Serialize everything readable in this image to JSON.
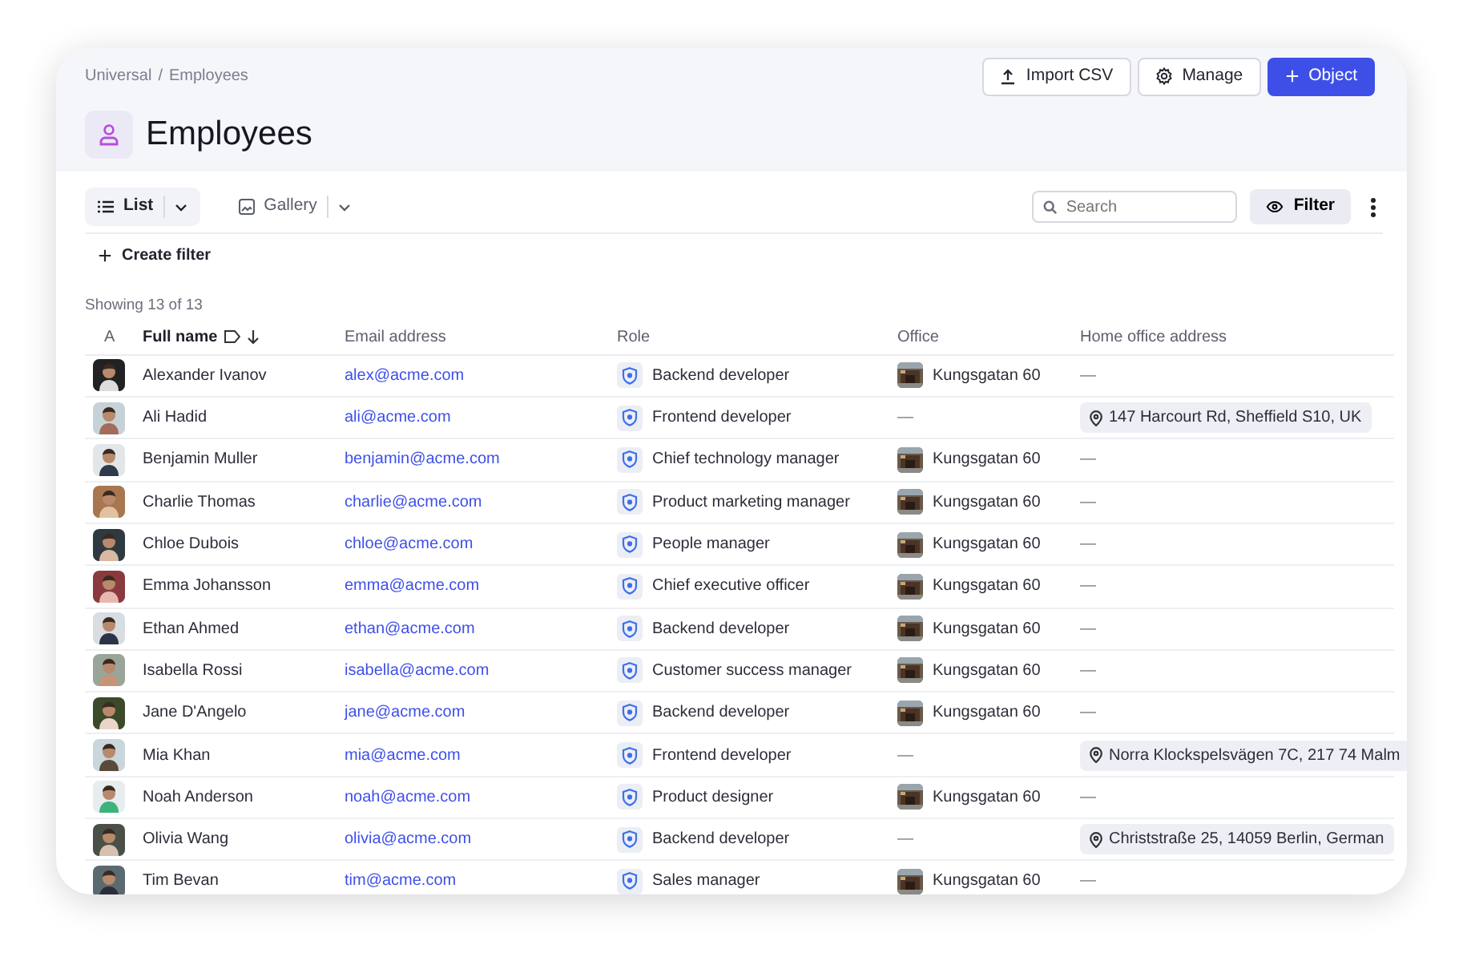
{
  "breadcrumbs": [
    "Universal",
    "Employees"
  ],
  "breadcrumb_separator": "/",
  "title": "Employees",
  "actions": [
    {
      "kind": "upload",
      "label": "Import CSV"
    },
    {
      "kind": "gear",
      "label": "Manage"
    },
    {
      "kind": "plus",
      "label": "Object",
      "primary": true
    }
  ],
  "views": [
    {
      "kind": "list",
      "label": "List",
      "selected": true
    },
    {
      "kind": "gallery",
      "label": "Gallery",
      "selected": false
    }
  ],
  "search": {
    "placeholder": "Search"
  },
  "filter_button": "Filter",
  "create_filter": "Create filter",
  "showing": "Showing 13 of 13",
  "columns": [
    {
      "label": "A",
      "sorted": false
    },
    {
      "label": "Full name",
      "sorted": true
    },
    {
      "label": "Email address",
      "sorted": false
    },
    {
      "label": "Role",
      "sorted": false
    },
    {
      "label": "Office",
      "sorted": false
    },
    {
      "label": "Home office address",
      "sorted": false
    }
  ],
  "rows": [
    {
      "name": "Alexander Ivanov",
      "email": "alex@acme.com",
      "role": "Backend developer",
      "office": {
        "kind": "place",
        "text": "Kungsgatan 60"
      },
      "home": {
        "kind": "none",
        "text": "—"
      }
    },
    {
      "name": "Ali Hadid",
      "email": "ali@acme.com",
      "role": "Frontend developer",
      "office": {
        "kind": "none",
        "text": "—"
      },
      "home": {
        "kind": "address",
        "text": "147 Harcourt Rd, Sheffield S10, UK"
      }
    },
    {
      "name": "Benjamin Muller",
      "email": "benjamin@acme.com",
      "role": "Chief technology manager",
      "office": {
        "kind": "place",
        "text": "Kungsgatan 60"
      },
      "home": {
        "kind": "none",
        "text": "—"
      }
    },
    {
      "name": "Charlie Thomas",
      "email": "charlie@acme.com",
      "role": "Product marketing manager",
      "office": {
        "kind": "place",
        "text": "Kungsgatan 60"
      },
      "home": {
        "kind": "none",
        "text": "—"
      }
    },
    {
      "name": "Chloe Dubois",
      "email": "chloe@acme.com",
      "role": "People manager",
      "office": {
        "kind": "place",
        "text": "Kungsgatan 60"
      },
      "home": {
        "kind": "none",
        "text": "—"
      }
    },
    {
      "name": "Emma Johansson",
      "email": "emma@acme.com",
      "role": "Chief executive officer",
      "office": {
        "kind": "place",
        "text": "Kungsgatan 60"
      },
      "home": {
        "kind": "none",
        "text": "—"
      }
    },
    {
      "name": "Ethan Ahmed",
      "email": "ethan@acme.com",
      "role": "Backend developer",
      "office": {
        "kind": "place",
        "text": "Kungsgatan 60"
      },
      "home": {
        "kind": "none",
        "text": "—"
      }
    },
    {
      "name": "Isabella Rossi",
      "email": "isabella@acme.com",
      "role": "Customer success manager",
      "office": {
        "kind": "place",
        "text": "Kungsgatan 60"
      },
      "home": {
        "kind": "none",
        "text": "—"
      }
    },
    {
      "name": "Jane D'Angelo",
      "email": "jane@acme.com",
      "role": "Backend developer",
      "office": {
        "kind": "place",
        "text": "Kungsgatan 60"
      },
      "home": {
        "kind": "none",
        "text": "—"
      }
    },
    {
      "name": "Mia Khan",
      "email": "mia@acme.com",
      "role": "Frontend developer",
      "office": {
        "kind": "none",
        "text": "—"
      },
      "home": {
        "kind": "address",
        "text": "Norra Klockspelsvägen 7C, 217 74 Malm"
      }
    },
    {
      "name": "Noah Anderson",
      "email": "noah@acme.com",
      "role": "Product designer",
      "office": {
        "kind": "place",
        "text": "Kungsgatan 60"
      },
      "home": {
        "kind": "none",
        "text": "—"
      }
    },
    {
      "name": "Olivia Wang",
      "email": "olivia@acme.com",
      "role": "Backend developer",
      "office": {
        "kind": "none",
        "text": "—"
      },
      "home": {
        "kind": "address",
        "text": "Christstraße 25, 14059 Berlin, German"
      }
    },
    {
      "name": "Tim Bevan",
      "email": "tim@acme.com",
      "role": "Sales manager",
      "office": {
        "kind": "place",
        "text": "Kungsgatan 60"
      },
      "home": {
        "kind": "none",
        "text": "—"
      }
    }
  ]
}
